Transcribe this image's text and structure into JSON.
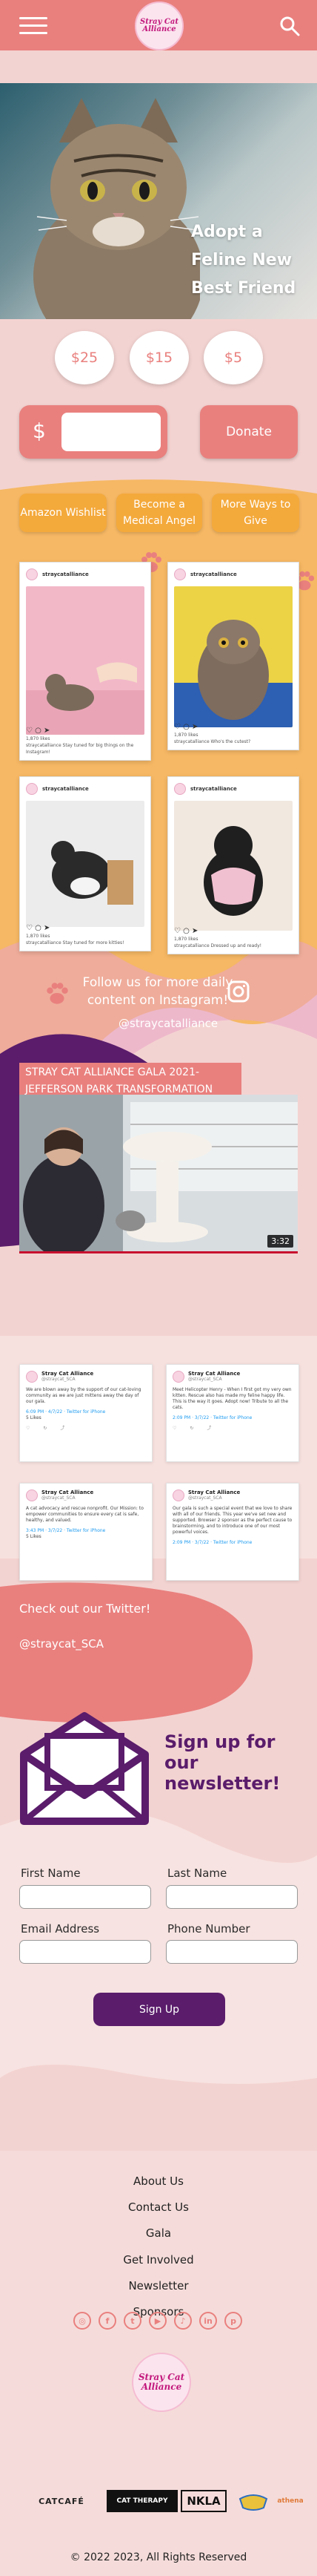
{
  "header": {
    "menu_icon": "hamburger-icon",
    "logo_text": "Stray Cat Alliance",
    "search_icon": "search-icon",
    "bg_color": "#e9807e"
  },
  "hero": {
    "headline_line1": "Adopt a",
    "headline_line2": "Feline New",
    "headline_line3": "Best Friend"
  },
  "donate": {
    "amounts": [
      "$25",
      "$15",
      "$5"
    ],
    "currency_symbol": "$",
    "amount_value": "",
    "button_label": "Donate"
  },
  "links": {
    "wishlist": "Amazon Wishlist",
    "medical_angel_1": "Become a",
    "medical_angel_2": "Medical Angel",
    "more_ways": "More Ways to Give"
  },
  "instagram": {
    "account": "straycatalliance",
    "posts": [
      {
        "likes": "1,870 likes",
        "caption": "straycatalliance Stay tuned for big things on the Instagram!"
      },
      {
        "likes": "1,870 likes",
        "caption": "straycatalliance Who's the cutest?"
      },
      {
        "likes": "1,870 likes",
        "caption": "straycatalliance Stay tuned for more kitties!"
      },
      {
        "likes": "1,870 likes",
        "caption": "straycatalliance Dressed up and ready!"
      }
    ],
    "follow_text": "Follow us for more daily content on Instagram!",
    "handle": "@straycatalliance",
    "icon": "instagram-icon"
  },
  "video": {
    "title": "STRAY CAT ALLIANCE GALA 2021- JEFFERSON PARK TRANSFORMATION",
    "duration": "3:32"
  },
  "twitter": {
    "tweets": [
      {
        "name": "Stray Cat Alliance",
        "handle": "@straycat_SCA",
        "body": "We are blown away by the support of our cat-loving community as we are just mittens away the day of our gala.",
        "meta": "6:09 PM · 4/7/22 · Twitter for iPhone",
        "likes": "5 Likes"
      },
      {
        "name": "Stray Cat Alliance",
        "handle": "@straycat_SCA",
        "body": "Meet Helicopter Henry - When I first got my very own kitten. Rescue also has made my feline happy life. This is the way it goes. Adopt now! Tribute to all the cats.",
        "meta": "2:09 PM · 3/7/22 · Twitter for iPhone",
        "likes": "5 Likes"
      },
      {
        "name": "Stray Cat Alliance",
        "handle": "@straycat_SCA",
        "body": "A cat advocacy and rescue nonprofit. Our Mission: to empower communities to ensure every cat is safe, healthy, and valued.",
        "meta": "3:43 PM · 3/7/22 · Twitter for iPhone",
        "likes": "5 Likes"
      },
      {
        "name": "Stray Cat Alliance",
        "handle": "@straycat_SCA",
        "body": "Our gala is such a special event that we love to share with all of our friends. This year we've set new and supported. Browser 2 sponsor as the perfect cause to brainstorming, and to introduce one of our most powerful voices.",
        "meta": "2:09 PM · 3/7/22 · Twitter for iPhone",
        "likes": "5 Likes"
      }
    ],
    "cta": "Check out our Twitter!",
    "handle": "@straycat_SCA"
  },
  "newsletter": {
    "title": "Sign up for our newsletter!",
    "first_name_label": "First Name",
    "last_name_label": "Last Name",
    "email_label": "Email Address",
    "phone_label": "Phone Number",
    "button_label": "Sign Up"
  },
  "footer": {
    "links": [
      "About Us",
      "Contact Us",
      "Gala",
      "Get Involved",
      "Newsletter",
      "Sponsors"
    ],
    "social_icons": [
      "instagram-icon",
      "facebook-icon",
      "twitter-icon",
      "youtube-icon",
      "tiktok-icon",
      "linkedin-icon",
      "pinterest-icon"
    ],
    "logo_text": "Stray Cat Alliance",
    "sponsors": [
      "CATCAFÉ",
      "CAT THERAPY",
      "NKLA",
      "",
      "athena"
    ],
    "copyright": "© 2022 2023, All Rights Reserved"
  },
  "colors": {
    "coral": "#e9807e",
    "orange": "#f4a93b",
    "purple": "#5a1c6b",
    "pink_bg": "#f3d3d1"
  }
}
